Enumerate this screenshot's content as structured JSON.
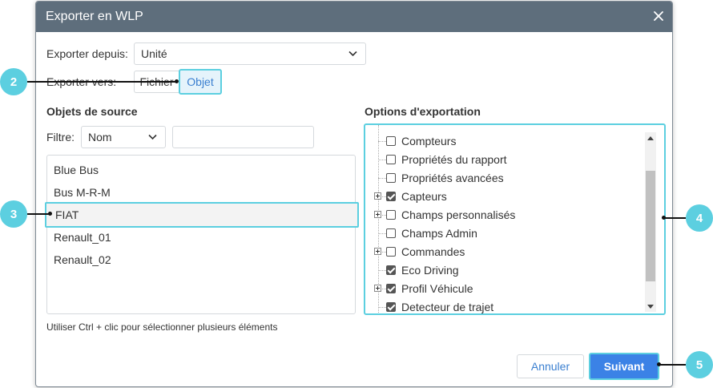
{
  "dialog": {
    "title": "Exporter en WLP"
  },
  "export_from": {
    "label": "Exporter depuis:",
    "value": "Unité"
  },
  "export_to": {
    "label": "Exporter vers:",
    "options": [
      "Fichier",
      "Objet"
    ],
    "selected": "Objet"
  },
  "source": {
    "heading": "Objets de source",
    "filter_label": "Filtre:",
    "filter_select": "Nom",
    "filter_input_value": "",
    "items": [
      "Blue Bus",
      "Bus M-R-M",
      "FIAT",
      "Renault_01",
      "Renault_02"
    ],
    "selected": "FIAT",
    "hint": "Utiliser Ctrl + clic pour sélectionner plusieurs éléments"
  },
  "options": {
    "heading": "Options d'exportation",
    "items": [
      {
        "label": "Compteurs",
        "checked": false,
        "expandable": false
      },
      {
        "label": "Propriétés du rapport",
        "checked": false,
        "expandable": false
      },
      {
        "label": "Propriétés avancées",
        "checked": false,
        "expandable": false
      },
      {
        "label": "Capteurs",
        "checked": true,
        "expandable": true
      },
      {
        "label": "Champs personnalisés",
        "checked": false,
        "expandable": true
      },
      {
        "label": "Champs Admin",
        "checked": false,
        "expandable": false
      },
      {
        "label": "Commandes",
        "checked": false,
        "expandable": true
      },
      {
        "label": "Eco Driving",
        "checked": true,
        "expandable": false
      },
      {
        "label": "Profil Véhicule",
        "checked": true,
        "expandable": true
      },
      {
        "label": "Detecteur de trajet",
        "checked": true,
        "expandable": false
      }
    ]
  },
  "buttons": {
    "cancel": "Annuler",
    "next": "Suivant"
  },
  "callouts": [
    "2",
    "3",
    "4",
    "5"
  ],
  "colors": {
    "titlebar": "#5e6e7c",
    "accent": "#5ccfe0",
    "primary": "#3b82e6",
    "link": "#3a7fd0"
  }
}
